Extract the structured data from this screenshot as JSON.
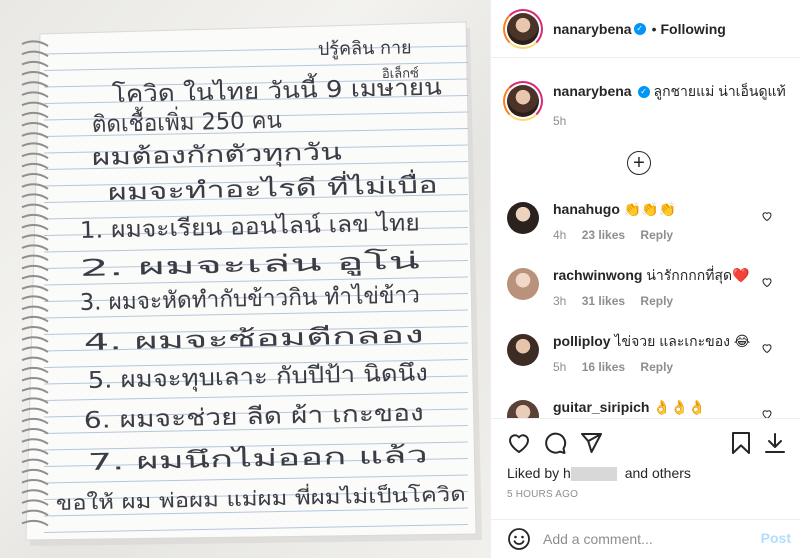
{
  "post": {
    "author": {
      "username": "nanarybena",
      "verified": true
    },
    "header": {
      "separator": "•",
      "follow_status": "Following"
    },
    "photo": {
      "handwriting": {
        "top_right": "ปรู้คลิน กาย",
        "top_right_sub": "อิเล็กซ์",
        "lines": [
          "โควิด ในไทย วันนี้ 9 เมษายน",
          "ติดเชื้อเพิ่ม 250 คน",
          "ผมต้องกักตัวทุกวัน",
          "ผมจะทำอะไรดี ที่ไม่เบื่อ",
          "1. ผมจะเรียน ออนไลน์ เลข ไทย",
          "2. ผมจะเล่น อูโน่",
          "3. ผมจะหัดทำกับข้าวกิน ทำไข่ข้าว",
          "4. ผมจะซ้อมตีกลอง",
          "5. ผมจะทุบเลาะ กับปีป้า นิดนึง",
          "6. ผมจะช่วย ลีด ผ้า เกะของ",
          "7. ผมนึกไม่ออก แล้ว",
          "ขอให้ ผม พ่อผม แม่ผม พี่ผมไม่เป็นโควิด"
        ]
      }
    },
    "caption": {
      "text": "ลูกชายแม่ น่าเอ็นดูแท้",
      "time": "5h"
    },
    "load_more": "+",
    "comments": [
      {
        "username": "hanahugo",
        "text": "👏👏👏",
        "time": "4h",
        "likes": "23 likes",
        "reply": "Reply"
      },
      {
        "username": "rachwinwong",
        "text": "น่ารักกกกที่สุด❤️",
        "time": "3h",
        "likes": "31 likes",
        "reply": "Reply"
      },
      {
        "username": "polliploy",
        "text": "ไข่จวย และเกะของ 😂",
        "time": "5h",
        "likes": "16 likes",
        "reply": "Reply"
      },
      {
        "username": "guitar_siripich",
        "text": "👌👌👌",
        "time": "",
        "likes": "",
        "reply": ""
      }
    ],
    "liked_by": {
      "prefix": "Liked by",
      "name_partial": "h",
      "suffix": "and others"
    },
    "timestamp": "5 HOURS AGO",
    "add_comment": {
      "placeholder": "Add a comment...",
      "post_label": "Post"
    },
    "colors": {
      "link_blue": "#0095f6",
      "post_disabled": "#b2dffc",
      "muted": "#8e8e8e",
      "text": "#262626",
      "heart_red": "#ed4956"
    },
    "icons": [
      "like-heart-icon",
      "comment-icon",
      "share-icon",
      "save-bookmark-icon",
      "download-icon",
      "emoji-icon",
      "add-circle-icon",
      "verified-badge-icon"
    ]
  }
}
